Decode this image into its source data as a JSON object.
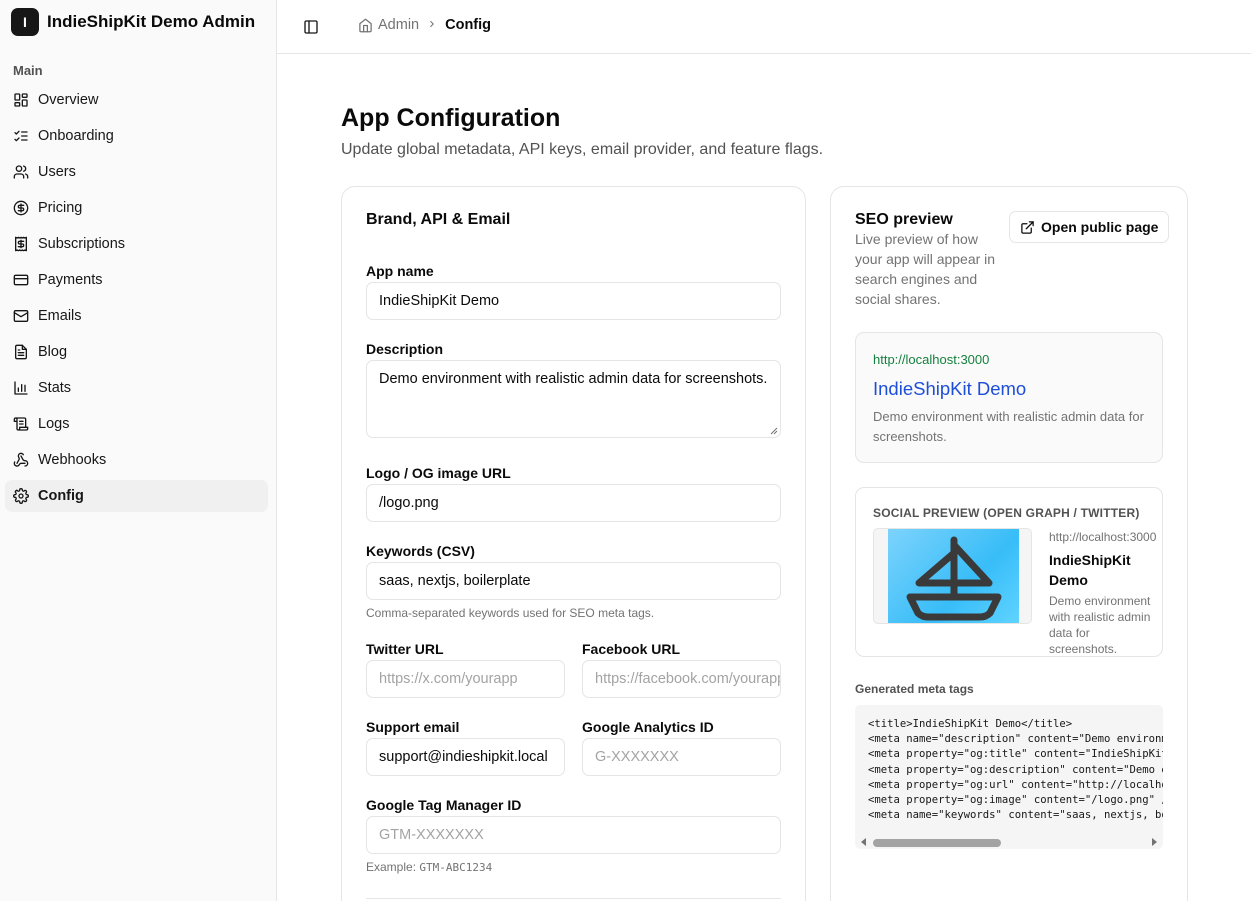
{
  "app": {
    "brand_initial": "I",
    "brand_name": "IndieShipKit Demo Admin"
  },
  "sidebar": {
    "section_label": "Main",
    "items": [
      {
        "label": "Overview",
        "icon": "layout-grid-icon"
      },
      {
        "label": "Onboarding",
        "icon": "list-checks-icon"
      },
      {
        "label": "Users",
        "icon": "users-icon"
      },
      {
        "label": "Pricing",
        "icon": "dollar-circle-icon"
      },
      {
        "label": "Subscriptions",
        "icon": "receipt-dollar-icon"
      },
      {
        "label": "Payments",
        "icon": "credit-card-icon"
      },
      {
        "label": "Emails",
        "icon": "mail-icon"
      },
      {
        "label": "Blog",
        "icon": "file-text-icon"
      },
      {
        "label": "Stats",
        "icon": "bar-chart-icon"
      },
      {
        "label": "Logs",
        "icon": "scroll-icon"
      },
      {
        "label": "Webhooks",
        "icon": "webhook-icon"
      },
      {
        "label": "Config",
        "icon": "gear-icon",
        "active": true
      }
    ]
  },
  "header": {
    "breadcrumb_root": "Admin",
    "breadcrumb_current": "Config"
  },
  "page": {
    "title": "App Configuration",
    "subtitle": "Update global metadata, API keys, email provider, and feature flags."
  },
  "form": {
    "card_title": "Brand, API & Email",
    "app_name": {
      "label": "App name",
      "value": "IndieShipKit Demo"
    },
    "description": {
      "label": "Description",
      "value": "Demo environment with realistic admin data for screenshots."
    },
    "logo_url": {
      "label": "Logo / OG image URL",
      "value": "/logo.png"
    },
    "keywords": {
      "label": "Keywords (CSV)",
      "value": "saas, nextjs, boilerplate",
      "hint": "Comma-separated keywords used for SEO meta tags."
    },
    "twitter_url": {
      "label": "Twitter URL",
      "value": "",
      "placeholder": "https://x.com/yourapp"
    },
    "facebook_url": {
      "label": "Facebook URL",
      "value": "",
      "placeholder": "https://facebook.com/yourapp"
    },
    "support_email": {
      "label": "Support email",
      "value": "support@indieshipkit.local"
    },
    "ga_id": {
      "label": "Google Analytics ID",
      "value": "",
      "placeholder": "G-XXXXXXX"
    },
    "gtm_id": {
      "label": "Google Tag Manager ID",
      "value": "",
      "placeholder": "GTM-XXXXXXX",
      "hint_prefix": "Example: ",
      "hint_code": "GTM-ABC1234"
    }
  },
  "seo": {
    "title": "SEO preview",
    "description": "Live preview of how your app will appear in search engines and social shares.",
    "open_button": "Open public page",
    "google": {
      "url": "http://localhost:3000",
      "title": "IndieShipKit Demo",
      "description": "Demo environment with realistic admin data for screenshots."
    },
    "social": {
      "label": "SOCIAL PREVIEW (OPEN GRAPH / TWITTER)",
      "url": "http://localhost:3000",
      "title": "IndieShipKit Demo",
      "description": "Demo environment with realistic admin data for screenshots."
    },
    "meta_label": "Generated meta tags",
    "meta_code": "<title>IndieShipKit Demo</title>\n<meta name=\"description\" content=\"Demo environment with realistic admin data for screenshots.\" />\n<meta property=\"og:title\" content=\"IndieShipKit Demo\" />\n<meta property=\"og:description\" content=\"Demo environment with realistic admin data for screenshots.\" />\n<meta property=\"og:url\" content=\"http://localhost:3000\" />\n<meta property=\"og:image\" content=\"/logo.png\" />\n<meta name=\"keywords\" content=\"saas, nextjs, boilerplate\" />"
  },
  "colors": {
    "accent_link": "#1d4ed8",
    "url_green": "#15803d",
    "og_image_sky": "#38bdf8"
  }
}
